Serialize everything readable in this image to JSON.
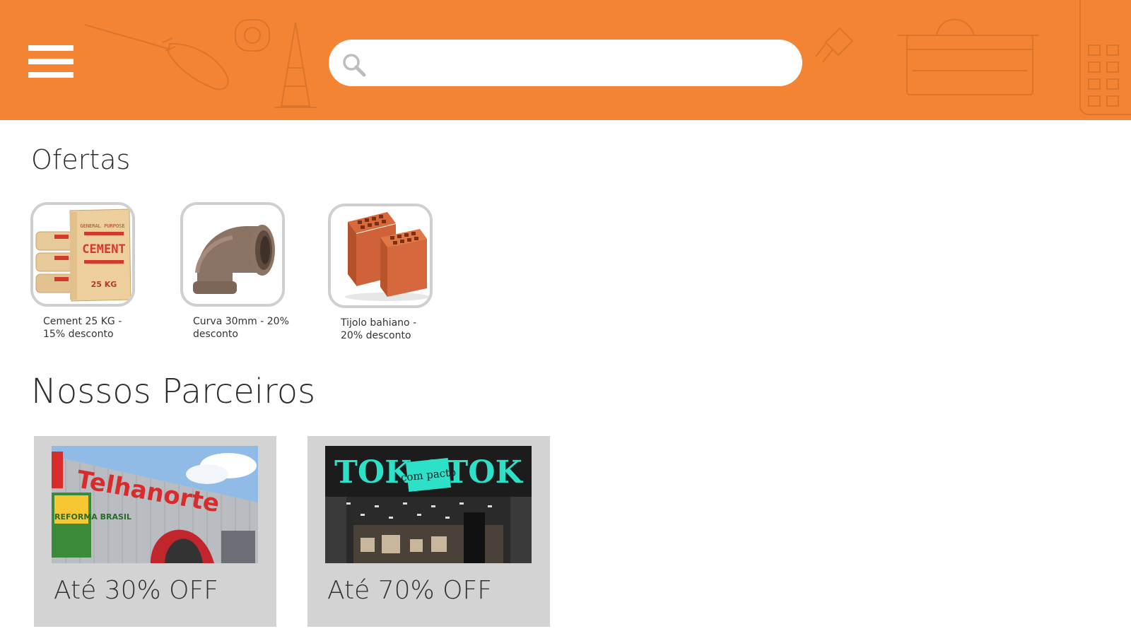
{
  "header": {
    "background_color": "#f28433",
    "menu_icon": "hamburger-menu-icon",
    "search": {
      "icon": "search-icon",
      "placeholder": "",
      "value": ""
    }
  },
  "offers": {
    "title": "Ofertas",
    "items": [
      {
        "image": "cement-bag-image",
        "caption": "Cement 25 KG - 15% desconto",
        "image_text": "CEMENT",
        "image_subtext": "25 KG",
        "image_top_text": "GENERAL PURPOSE"
      },
      {
        "image": "pipe-elbow-image",
        "caption": "Curva 30mm - 20% desconto"
      },
      {
        "image": "brick-image",
        "caption": "Tijolo bahiano - 20% desconto"
      }
    ]
  },
  "partners": {
    "title": "Nossos Parceiros",
    "items": [
      {
        "image": "telhanorte-store-image",
        "brand_text": "Telhanorte",
        "banner_text": "REFORMA BRASIL",
        "offer": "Até 30% OFF"
      },
      {
        "image": "tokstok-store-image",
        "brand_text": "TOK STOK",
        "banner_text": "com pacto",
        "offer": "Até 70% OFF"
      }
    ]
  }
}
